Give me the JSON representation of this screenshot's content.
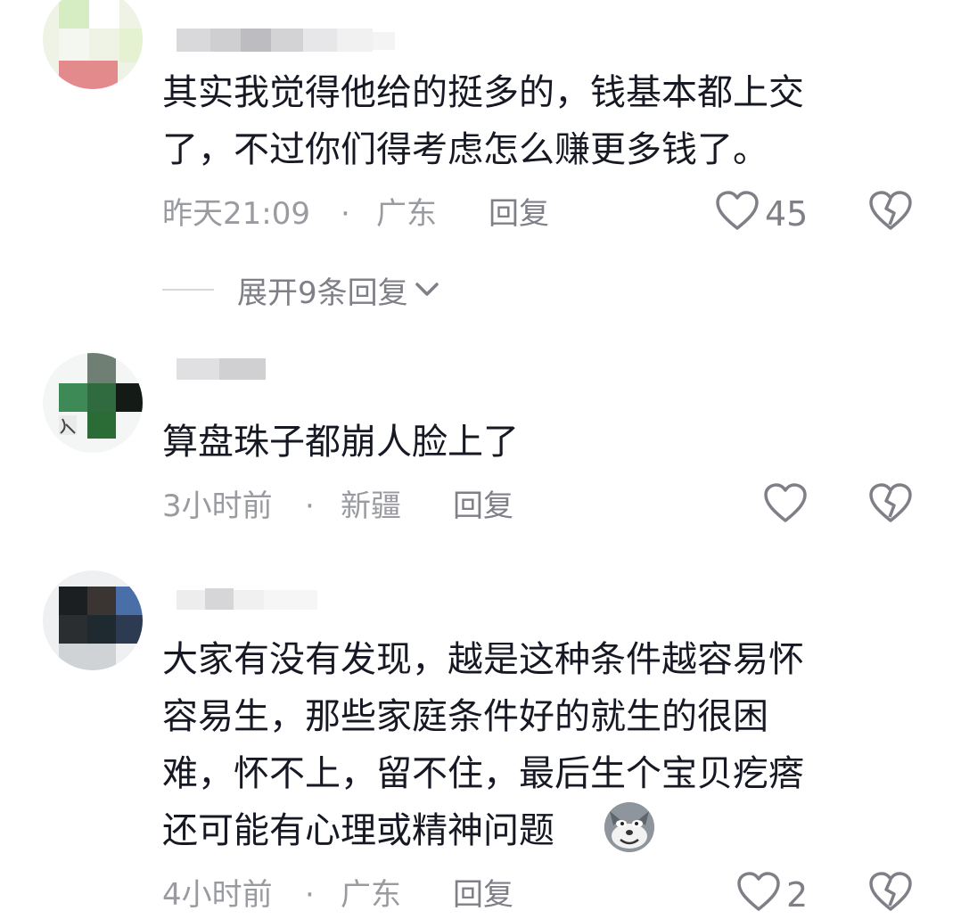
{
  "comments": [
    {
      "text_lines": [
        "其实我觉得他给的挺多的，钱基本都上交",
        "了，不过你们得考虑怎么赚更多钱了。"
      ],
      "time": "昨天21:09",
      "separator": "·",
      "location": "广东",
      "reply_label": "回复",
      "like_count": "45",
      "expand_replies": "展开9条回复"
    },
    {
      "text_lines": [
        "算盘珠子都崩人脸上了"
      ],
      "time": "3小时前",
      "separator": "·",
      "location": "新疆",
      "reply_label": "回复",
      "like_count": ""
    },
    {
      "text_lines": [
        "大家有没有发现，越是这种条件越容易怀",
        "容易生，那些家庭条件好的就生的很困",
        "难，怀不上，留不住，最后生个宝贝疙瘩",
        "还可能有心理或精神问题"
      ],
      "time": "4小时前",
      "separator": "·",
      "location": "广东",
      "reply_label": "回复",
      "like_count": "2"
    }
  ],
  "colors": {
    "text": "#161823",
    "meta": "#9a9ba1",
    "action": "#7f8087"
  },
  "icons": {
    "like": "heart-outline-icon",
    "dislike": "broken-heart-icon",
    "expand": "chevron-down-icon",
    "emoji": "wolf-emoji-icon"
  }
}
